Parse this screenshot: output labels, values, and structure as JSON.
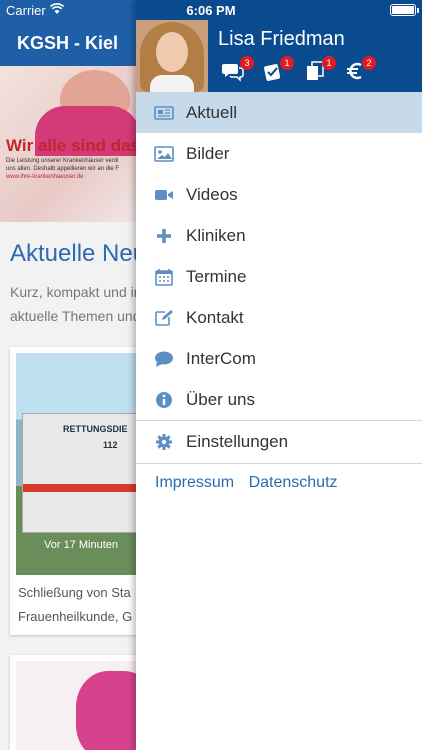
{
  "status_bar": {
    "carrier": "Carrier",
    "time": "6:06 PM"
  },
  "background_app": {
    "title": "KGSH - Kiel",
    "banner_slogan": "Wir alle sind das",
    "banner_text_1": "Die Leistung unserer Krankenhäuser verdi",
    "banner_text_2": "uns allen. Deshalb appellieren wir an die F",
    "banner_url": "www.ihre-krankenhaeuser.de",
    "section_heading": "Aktuelle Neu",
    "intro_line_1": "Kurz, kompakt und in",
    "intro_line_2": "aktuelle Themen und",
    "van_text": "RETTUNGSDIE",
    "van_number": "112",
    "article_age": "Vor 17 Minuten",
    "article_text_1": "Schließung von Sta",
    "article_text_2": "Frauenheilkunde, G"
  },
  "drawer": {
    "user_name": "Lisa Friedman",
    "header_icons": [
      {
        "icon": "chat-bubbles-icon",
        "badge": "3"
      },
      {
        "icon": "tasks-icon",
        "badge": "1"
      },
      {
        "icon": "documents-icon",
        "badge": "1"
      },
      {
        "icon": "euro-icon",
        "badge": "2"
      }
    ],
    "menu": [
      {
        "label": "Aktuell",
        "icon": "newspaper-icon",
        "active": true
      },
      {
        "label": "Bilder",
        "icon": "image-icon",
        "active": false
      },
      {
        "label": "Videos",
        "icon": "video-camera-icon",
        "active": false
      },
      {
        "label": "Kliniken",
        "icon": "plus-icon",
        "active": false
      },
      {
        "label": "Termine",
        "icon": "calendar-icon",
        "active": false
      },
      {
        "label": "Kontakt",
        "icon": "edit-icon",
        "active": false
      },
      {
        "label": "InterCom",
        "icon": "chat-bubble-icon",
        "active": false
      },
      {
        "label": "Über uns",
        "icon": "info-icon",
        "active": false
      }
    ],
    "settings_label": "Einstellungen",
    "footer": {
      "impressum": "Impressum",
      "datenschutz": "Datenschutz"
    },
    "accent_color": "#2b6bb1",
    "header_color": "#0a4a8f",
    "active_item_color": "#c6daea",
    "badge_color": "#e01b22"
  }
}
